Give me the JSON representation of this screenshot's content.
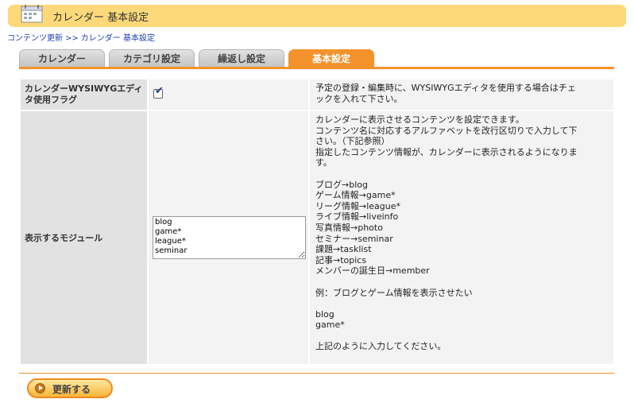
{
  "header": {
    "title": "カレンダー 基本設定",
    "icon": "calendar-icon"
  },
  "breadcrumb": {
    "items": [
      "コンテンツ更新",
      "カレンダー 基本設定"
    ],
    "separator": ">>"
  },
  "tabs": [
    {
      "label": "カレンダー",
      "active": false
    },
    {
      "label": "カテゴリ設定",
      "active": false
    },
    {
      "label": "繰返し設定",
      "active": false
    },
    {
      "label": "基本設定",
      "active": true
    }
  ],
  "settings": {
    "wysiwyg": {
      "label_lines": [
        "カレンダーWYSIWYGエディ",
        "タ使用フラグ"
      ],
      "checked": true,
      "description_lines": [
        "予定の登録・編集時に、WYSIWYGエディタを使用する場合はチェ",
        "ックを入れて下さい。"
      ]
    },
    "modules": {
      "label": "表示するモジュール",
      "textarea_value": "blog\ngame*\nleague*\nseminar",
      "description_lines": [
        "カレンダーに表示させるコンテンツを設定できます。",
        "コンテンツ名に対応するアルファベットを改行区切りで入力して下",
        "さい。（下記参照）",
        "指定したコンテンツ情報が、カレンダーに表示されるようになりま",
        "す。",
        "",
        "ブログ→blog",
        "ゲーム情報→game*",
        "リーグ情報→league*",
        "ライブ情報→liveinfo",
        "写真情報→photo",
        "セミナー→seminar",
        "課題→tasklist",
        "記事→topics",
        "メンバーの誕生日→member",
        "",
        "例：ブログとゲーム情報を表示させたい",
        "",
        "blog",
        "game*",
        "",
        "上記のように入力してください。"
      ]
    }
  },
  "submit": {
    "label": "更新する",
    "icon": "arrow-right-icon"
  },
  "colors": {
    "header_bg": "#fdd97a",
    "accent": "#f4922b",
    "link": "#1d3fb0"
  }
}
